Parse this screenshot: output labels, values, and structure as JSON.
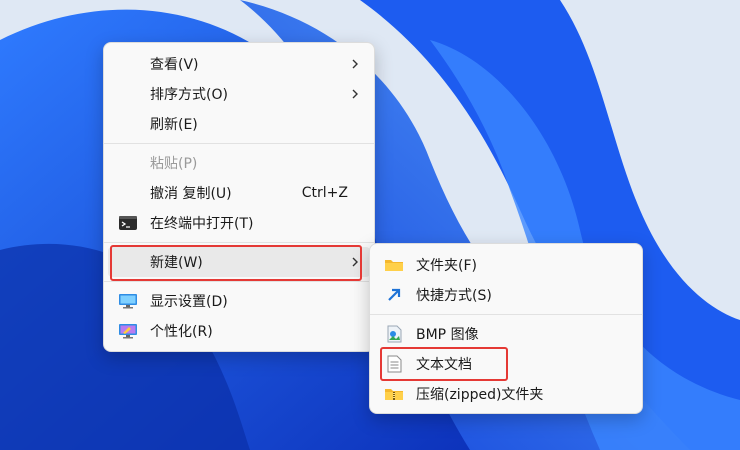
{
  "context_menu": {
    "items": [
      {
        "label": "查看(V)"
      },
      {
        "label": "排序方式(O)"
      },
      {
        "label": "刷新(E)"
      },
      {
        "label": "粘贴(P)"
      },
      {
        "label": "撤消 复制(U)",
        "shortcut": "Ctrl+Z"
      },
      {
        "label": "在终端中打开(T)"
      },
      {
        "label": "新建(W)"
      },
      {
        "label": "显示设置(D)"
      },
      {
        "label": "个性化(R)"
      }
    ]
  },
  "new_submenu": {
    "items": [
      {
        "label": "文件夹(F)"
      },
      {
        "label": "快捷方式(S)"
      },
      {
        "label": "BMP 图像"
      },
      {
        "label": "文本文档"
      },
      {
        "label": "压缩(zipped)文件夹"
      }
    ]
  },
  "colors": {
    "highlight_box": "#e53935",
    "wallpaper_blue": "#1a56e8",
    "menu_background": "#f9f9f9"
  }
}
